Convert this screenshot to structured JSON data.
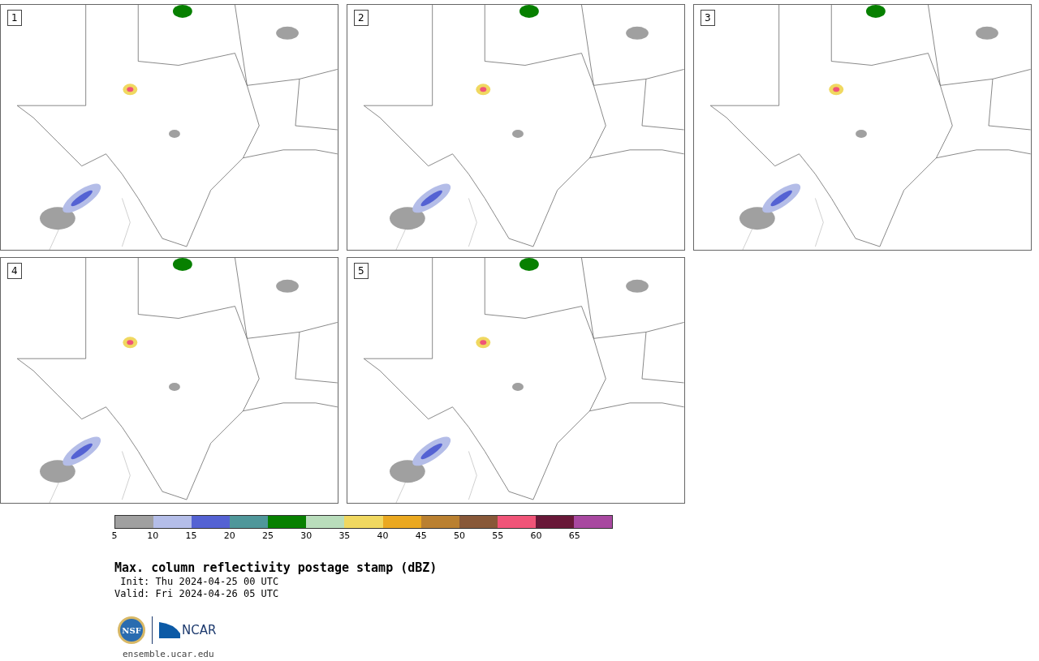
{
  "panels": [
    {
      "label": "1"
    },
    {
      "label": "2"
    },
    {
      "label": "3"
    },
    {
      "label": "4"
    },
    {
      "label": "5"
    }
  ],
  "colorbar": {
    "bins": [
      {
        "color": "#a0a0a0"
      },
      {
        "color": "#b4bde8"
      },
      {
        "color": "#5462d3"
      },
      {
        "color": "#4f979a"
      },
      {
        "color": "#078000"
      },
      {
        "color": "#b9ddbb"
      },
      {
        "color": "#f0d860"
      },
      {
        "color": "#eaa820"
      },
      {
        "color": "#ba8030"
      },
      {
        "color": "#885838"
      },
      {
        "color": "#f05478"
      },
      {
        "color": "#681838"
      },
      {
        "color": "#a848a0"
      }
    ],
    "ticks": [
      "5",
      "10",
      "15",
      "20",
      "25",
      "30",
      "35",
      "40",
      "45",
      "50",
      "55",
      "60",
      "65"
    ]
  },
  "title": "Max. column reflectivity postage stamp (dBZ)",
  "init": " Init: Thu 2024-04-25 00 UTC",
  "valid": "Valid: Fri 2024-04-26 05 UTC",
  "logos": {
    "nsf": "NSF",
    "ncar": "NCAR"
  },
  "site": "ensemble.ucar.edu"
}
